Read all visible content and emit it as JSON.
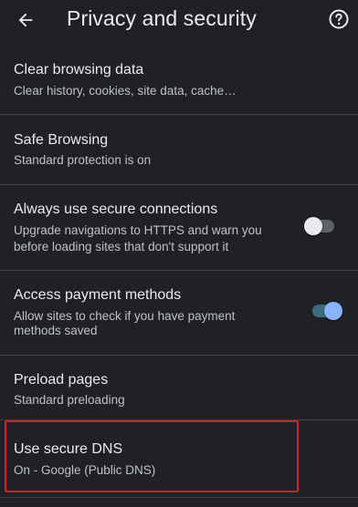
{
  "header": {
    "title": "Privacy and security",
    "back_icon": "arrow-back-icon",
    "help_icon": "help-circle-icon"
  },
  "settings": [
    {
      "title": "Clear browsing data",
      "subtitle_lines": [
        "Clear history, cookies, site data, cache…"
      ]
    },
    {
      "title": "Safe Browsing",
      "subtitle_lines": [
        "Standard protection is on"
      ]
    },
    {
      "title": "Always use secure connections",
      "subtitle_lines": [
        "Upgrade navigations to HTTPS and warn you",
        "before loading sites that don't support it"
      ],
      "toggle": "off"
    },
    {
      "title": "Access payment methods",
      "subtitle_lines": [
        "Allow sites to check if you have payment",
        "methods saved"
      ],
      "toggle": "on"
    },
    {
      "title": "Preload pages",
      "subtitle_lines": [
        "Standard preloading"
      ]
    },
    {
      "title": "Use secure DNS",
      "subtitle_lines": [
        "On - Google (Public DNS)"
      ],
      "highlighted": true
    }
  ],
  "colors": {
    "background": "#202124",
    "text_primary": "#e8eaed",
    "text_secondary": "#bdc1c6",
    "toggle_on": "#8ab4f8",
    "highlight_box": "#d0202e"
  }
}
